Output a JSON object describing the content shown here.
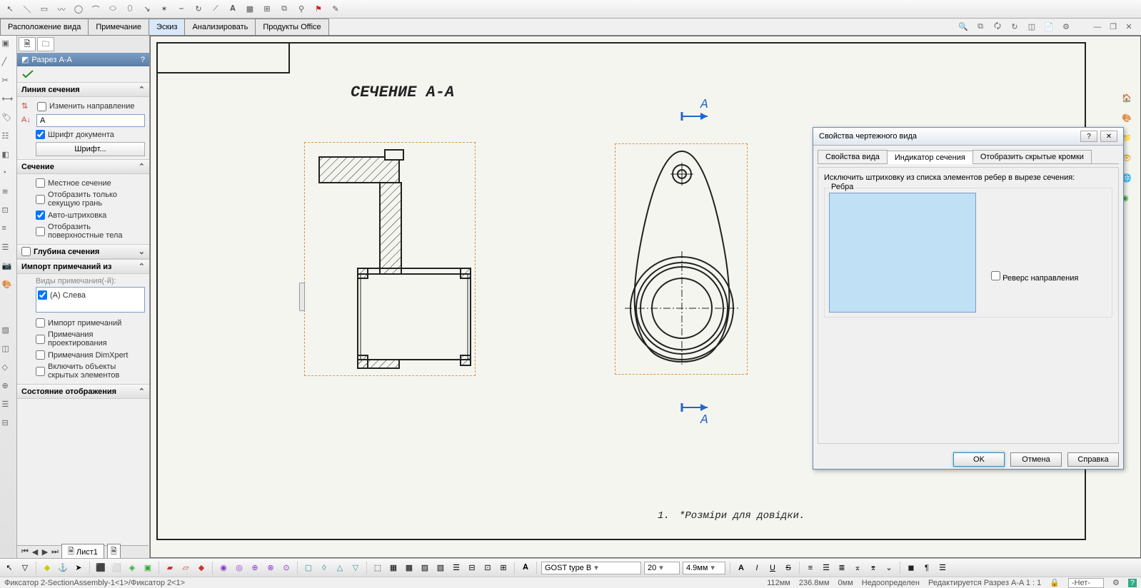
{
  "toolbar_icons": [
    "mouse",
    "line",
    "rect",
    "spline",
    "circle",
    "arc",
    "ellipse",
    "slot",
    "move",
    "star",
    "fillet",
    "text",
    "dimension",
    "table",
    "grid",
    "constraint",
    "ref",
    "flag",
    "script"
  ],
  "tabs": {
    "items": [
      "Расположение вида",
      "Примечание",
      "Эскиз",
      "Анализировать",
      "Продукты Office"
    ],
    "active_index": 2
  },
  "view_icons": [
    "zoom-fit",
    "zoom-window",
    "rotate",
    "refresh",
    "display-style",
    "section",
    "render",
    "options"
  ],
  "prop": {
    "title": "Разрез A-A",
    "s_line": "Линия сечения",
    "change_dir": "Изменить направление",
    "label_value": "A",
    "doc_font": "Шрифт документа",
    "font_btn": "Шрифт...",
    "s_section": "Сечение",
    "local": "Местное сечение",
    "cut_only": "Отобразить только секущую грань",
    "auto_hatch": "Авто-штриховка",
    "surf_bodies": "Отобразить поверхностные тела",
    "s_depth": "Глубина сечения",
    "s_import": "Импорт примечаний из",
    "views_label": "Виды примечания(-й):",
    "view_a": "(A) Слева",
    "imp_notes": "Импорт примечаний",
    "proj_notes": "Примечания проектирования",
    "dimxpert": "Примечания DimXpert",
    "incl_hidden": "Включить объекты скрытых элементов",
    "s_display": "Состояние отображения"
  },
  "canvas": {
    "title": "СЕЧЕНИЕ A-A",
    "arrow_a": "А",
    "note_num": "1.",
    "note_text": "*Розміри для довідки."
  },
  "sheet": {
    "tab1": "Лист1"
  },
  "dialog": {
    "title": "Свойства чертежного вида",
    "tabs": [
      "Свойства вида",
      "Индикатор сечения",
      "Отобразить скрытые кромки"
    ],
    "active": 1,
    "instruction": "Исключить штриховку из списка элементов ребер в вырезе сечения:",
    "legend": "Ребра",
    "reverse": "Реверс направления",
    "ok": "OK",
    "cancel": "Отмена",
    "help": "Справка"
  },
  "bottom": {
    "font_name": "GOST type B",
    "font_size": "20",
    "dim_val": "4.9мм"
  },
  "status": {
    "doc": "Фиксатор 2-SectionAssembly-1<1>/Фиксатор 2<1>",
    "coord1": "112мм",
    "coord2": "236.8мм",
    "coord3": "0мм",
    "mode": "Недоопределен",
    "edit": "Редактируется Разрез A-A   1 : 1",
    "layer": "-Нет-"
  }
}
